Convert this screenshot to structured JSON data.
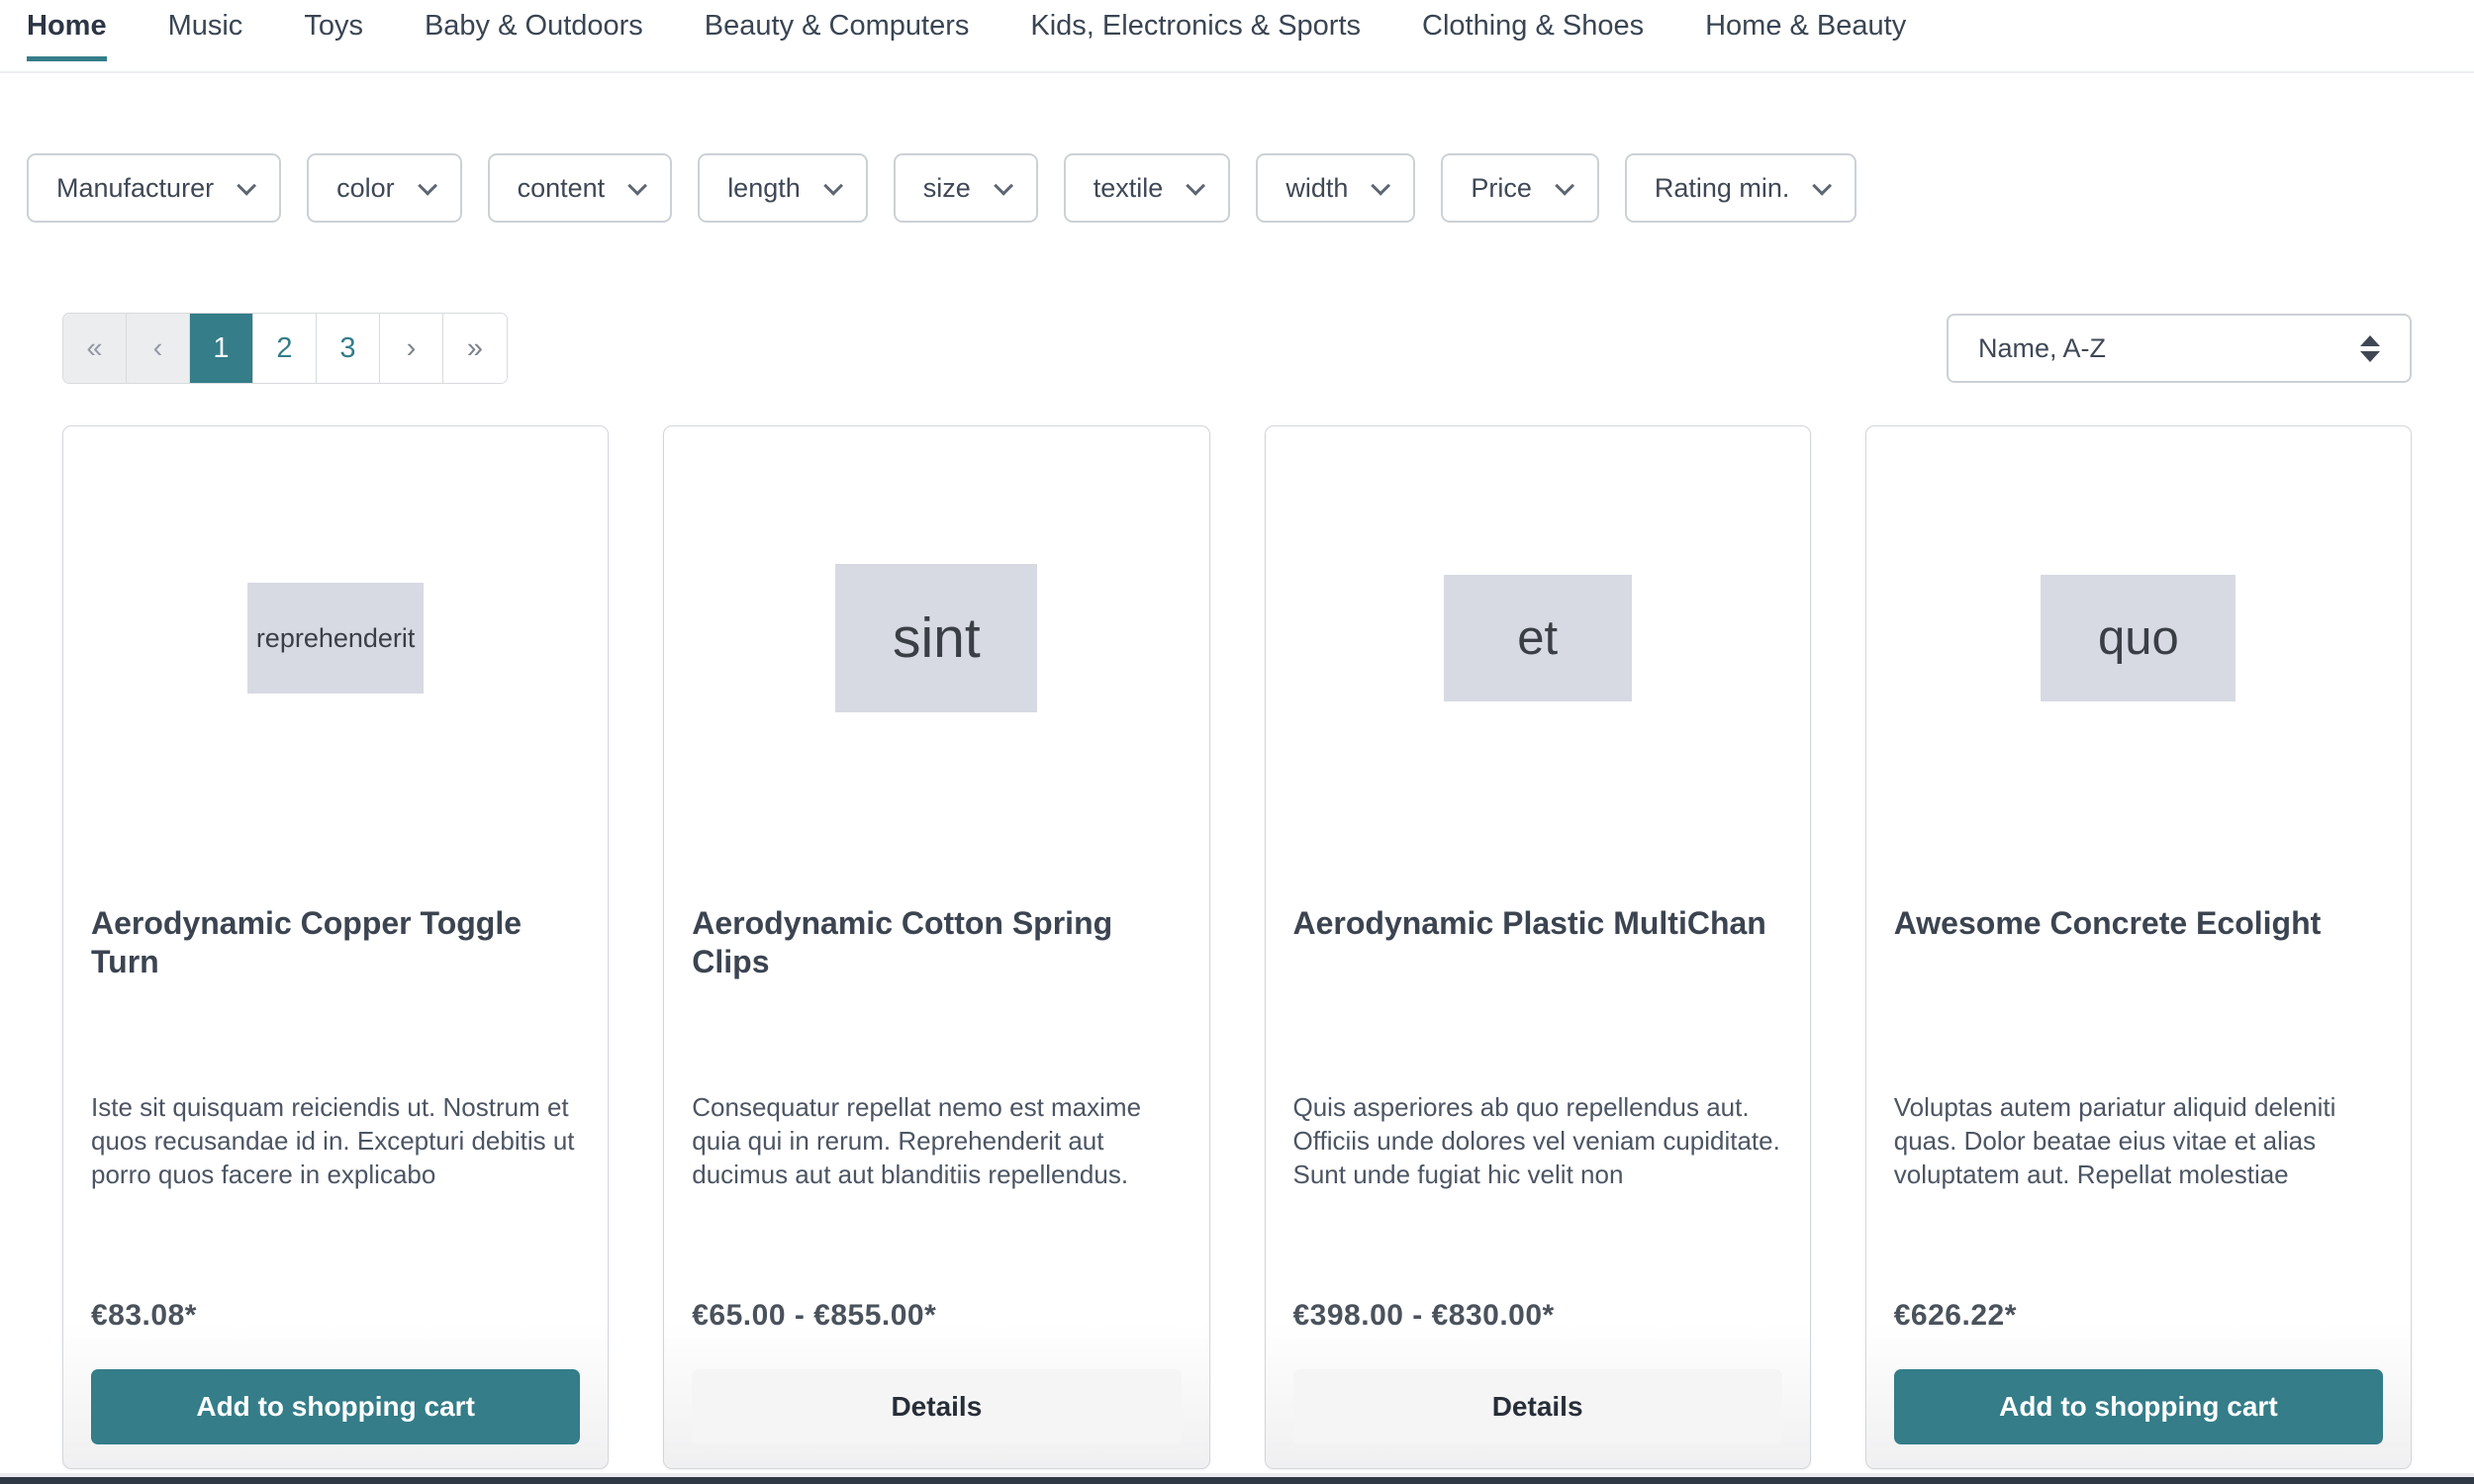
{
  "nav": {
    "items": [
      {
        "label": "Home"
      },
      {
        "label": "Music"
      },
      {
        "label": "Toys"
      },
      {
        "label": "Baby & Outdoors"
      },
      {
        "label": "Beauty & Computers"
      },
      {
        "label": "Kids, Electronics & Sports"
      },
      {
        "label": "Clothing & Shoes"
      },
      {
        "label": "Home & Beauty"
      }
    ],
    "active": "Home"
  },
  "filters": [
    {
      "label": "Manufacturer"
    },
    {
      "label": "color"
    },
    {
      "label": "content"
    },
    {
      "label": "length"
    },
    {
      "label": "size"
    },
    {
      "label": "textile"
    },
    {
      "label": "width"
    },
    {
      "label": "Price"
    },
    {
      "label": "Rating min."
    }
  ],
  "pagination": {
    "first_label": "«",
    "prev_label": "‹",
    "page_1": "1",
    "page_2": "2",
    "page_3": "3",
    "next_label": "›",
    "last_label": "»",
    "active_page": "1"
  },
  "sort": {
    "selected": "Name, A-Z"
  },
  "products": [
    {
      "image_text": "reprehenderit",
      "title": "Aerodynamic Copper Toggle Turn",
      "description": "Iste sit quisquam reiciendis ut. Nostrum et quos recusandae id in. Excepturi debitis ut porro quos facere in explicabo",
      "price": "€83.08*",
      "action_label": "Add to shopping cart"
    },
    {
      "image_text": "sint",
      "title": "Aerodynamic Cotton Spring Clips",
      "description": "Consequatur repellat nemo est maxime quia qui in rerum. Reprehenderit aut ducimus aut aut blanditiis repellendus.",
      "price": "€65.00 - €855.00*",
      "action_label": "Details"
    },
    {
      "image_text": "et",
      "title": "Aerodynamic Plastic MultiChan",
      "description": "Quis asperiores ab quo repellendus aut. Officiis unde dolores vel veniam cupiditate. Sunt unde fugiat hic velit non",
      "price": "€398.00 - €830.00*",
      "action_label": "Details"
    },
    {
      "image_text": "quo",
      "title": "Awesome Concrete Ecolight",
      "description": "Voluptas autem pariatur aliquid deleniti quas. Dolor beatae eius vitae et alias voluptatem aut. Repellat molestiae",
      "price": "€626.22*",
      "action_label": "Add to shopping cart"
    }
  ],
  "colors": {
    "accent_teal": "#347d89",
    "placeholder_bg": "#d7dae2",
    "footer_bar": "#2f3945",
    "pagination_disabled_bg": "#ecedef"
  }
}
